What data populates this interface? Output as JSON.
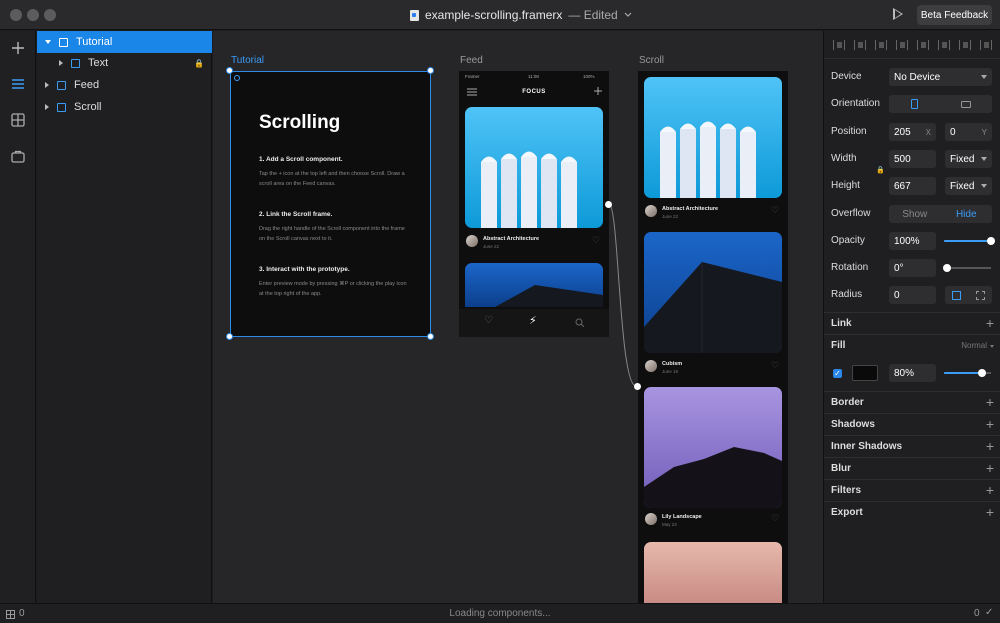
{
  "window": {
    "filename": "example-scrolling.framerx",
    "status": "— Edited",
    "beta_button": "Beta Feedback"
  },
  "rail": {
    "icons": [
      "plus-icon",
      "layers-icon",
      "grid-icon",
      "store-icon"
    ]
  },
  "layers": [
    {
      "label": "Tutorial",
      "active": true
    },
    {
      "label": "Text",
      "active": false
    },
    {
      "label": "Feed",
      "active": false
    },
    {
      "label": "Scroll",
      "active": false
    }
  ],
  "canvas": {
    "labels": {
      "tutorial": "Tutorial",
      "feed": "Feed",
      "scroll": "Scroll"
    },
    "tutorial": {
      "title": "Scrolling",
      "steps": [
        {
          "heading": "1. Add a Scroll component.",
          "body": "Tap the + icon at the top left and then choose Scroll. Draw a scroll area on the Feed canvas."
        },
        {
          "heading": "2. Link the Scroll frame.",
          "body": "Drag the right handle of the Scroll component into the frame on the Scroll canvas next to it."
        },
        {
          "heading": "3. Interact with the prototype.",
          "body": "Enter preview mode by pressing ⌘P or clicking the play icon at the top right of the app."
        }
      ]
    },
    "feed": {
      "status_left": "Framer",
      "status_time": "11:08",
      "status_right": "100%",
      "header": "FOCUS",
      "cards": [
        {
          "title": "Abstract Architecture",
          "date": "June 22"
        }
      ]
    },
    "scroll": {
      "cards": [
        {
          "title": "Abstract Architecture",
          "date": "June 22"
        },
        {
          "title": "Cubism",
          "date": "June 19"
        },
        {
          "title": "Lily Landscape",
          "date": "May 23"
        }
      ]
    }
  },
  "props": {
    "device": {
      "label": "Device",
      "value": "No Device"
    },
    "orientation": {
      "label": "Orientation"
    },
    "position": {
      "label": "Position",
      "x": "205",
      "x_unit": "X",
      "y": "0",
      "y_unit": "Y"
    },
    "width": {
      "label": "Width",
      "value": "500",
      "mode": "Fixed"
    },
    "height": {
      "label": "Height",
      "value": "667",
      "mode": "Fixed"
    },
    "overflow": {
      "label": "Overflow",
      "show": "Show",
      "hide": "Hide"
    },
    "opacity": {
      "label": "Opacity",
      "value": "100%",
      "level": 1.0
    },
    "rotation": {
      "label": "Rotation",
      "value": "0°"
    },
    "radius": {
      "label": "Radius",
      "value": "0"
    },
    "link": "Link",
    "fill": {
      "label": "Fill",
      "mode": "Normal",
      "opacity": "80%",
      "level": 0.8
    },
    "sections": [
      "Border",
      "Shadows",
      "Inner Shadows",
      "Blur",
      "Filters",
      "Export"
    ]
  },
  "statusbar": {
    "left_count": "0",
    "loading": "Loading components...",
    "right_count": "0"
  },
  "colors": {
    "accent": "#1a86e8",
    "background": "#1c1c1e"
  }
}
